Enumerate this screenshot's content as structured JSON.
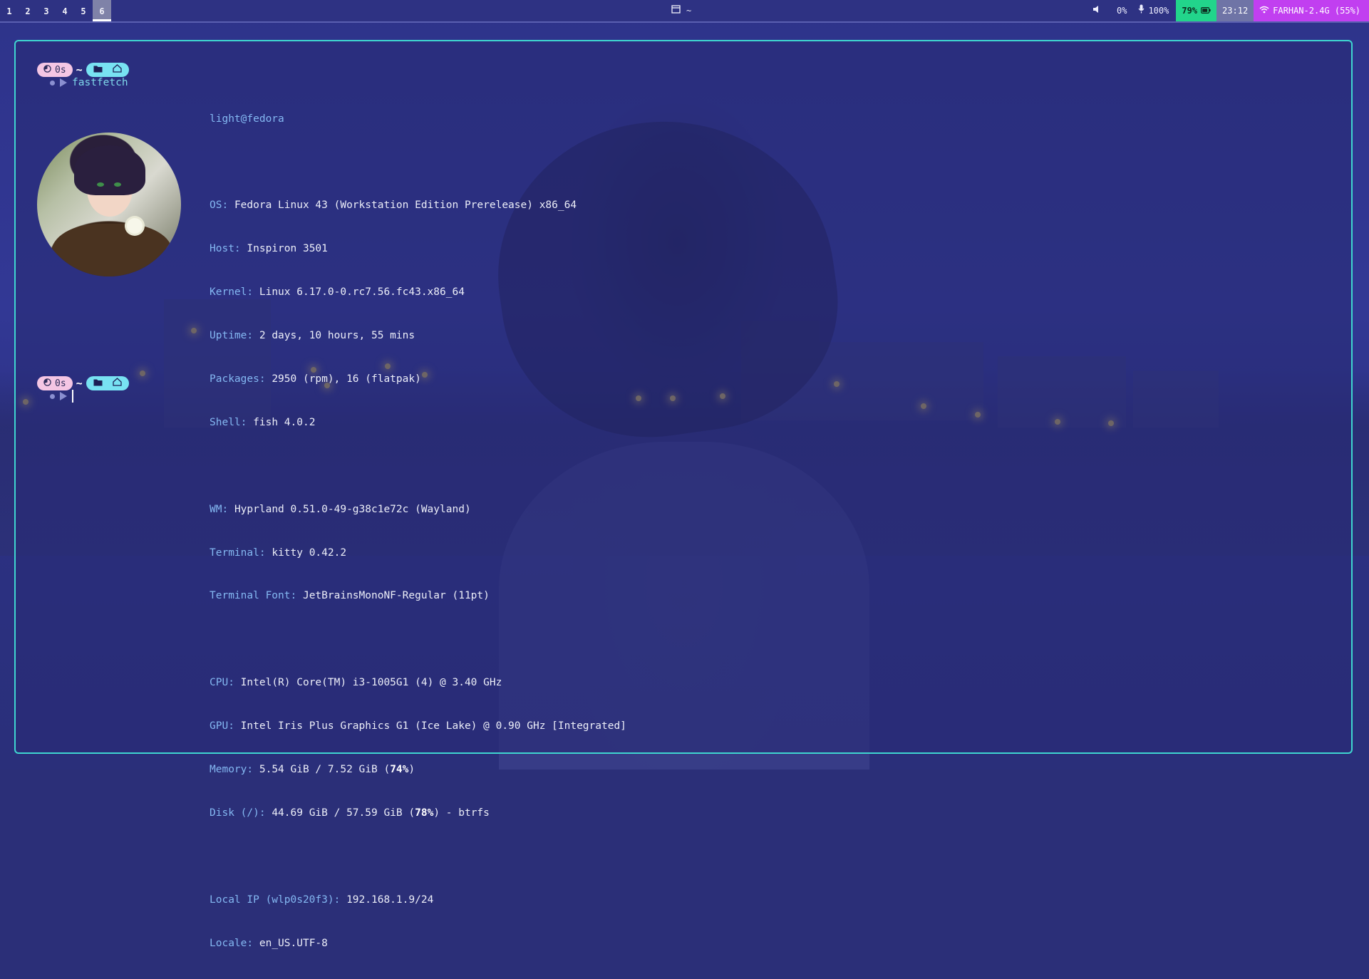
{
  "topbar": {
    "workspaces": [
      "1",
      "2",
      "3",
      "4",
      "5",
      "6"
    ],
    "active_workspace": "6",
    "window_title": "~",
    "volume": "0%",
    "mic": "100%",
    "battery": "79%",
    "clock": "23:12",
    "wifi": "FARHAN-2.4G (55%)"
  },
  "terminal": {
    "prompt": {
      "time": "0s",
      "path": "~"
    },
    "command": "fastfetch",
    "user_host": "light@fedora",
    "info": [
      {
        "key": "OS",
        "value": "Fedora Linux 43 (Workstation Edition Prerelease) x86_64"
      },
      {
        "key": "Host",
        "value": "Inspiron 3501"
      },
      {
        "key": "Kernel",
        "value": "Linux 6.17.0-0.rc7.56.fc43.x86_64"
      },
      {
        "key": "Uptime",
        "value": "2 days, 10 hours, 55 mins"
      },
      {
        "key": "Packages",
        "value": "2950 (rpm), 16 (flatpak)"
      },
      {
        "key": "Shell",
        "value": "fish 4.0.2"
      },
      {
        "key": "WM",
        "value": "Hyprland 0.51.0-49-g38c1e72c (Wayland)"
      },
      {
        "key": "Terminal",
        "value": "kitty 0.42.2"
      },
      {
        "key": "Terminal Font",
        "value": "JetBrainsMonoNF-Regular (11pt)"
      },
      {
        "key": "CPU",
        "value": "Intel(R) Core(TM) i3-1005G1 (4) @ 3.40 GHz"
      },
      {
        "key": "GPU",
        "value": "Intel Iris Plus Graphics G1 (Ice Lake) @ 0.90 GHz [Integrated]"
      },
      {
        "key": "Memory",
        "value_a": "5.54 GiB / 7.52 GiB (",
        "pct": "74%",
        "value_b": ")"
      },
      {
        "key": "Disk (/)",
        "value_a": "44.69 GiB / 57.59 GiB (",
        "pct": "78%",
        "value_b": ") - btrfs"
      },
      {
        "key": "Local IP (wlp0s20f3)",
        "value": "192.168.1.9/24"
      },
      {
        "key": "Locale",
        "value": "en_US.UTF-8"
      }
    ]
  },
  "icons": {
    "volume": "speaker-muted-icon",
    "mic": "microphone-icon",
    "battery": "battery-icon",
    "wifi": "wifi-icon",
    "window": "window-icon",
    "timer": "timer-icon",
    "folder": "folder-icon",
    "home": "home-icon"
  },
  "colors": {
    "accent_border": "#3fd6d0",
    "battery_bg": "#22d58b",
    "wifi_bg": "#c13ff0",
    "key_color": "#84b8f2",
    "pill_time": "#f4c6e4",
    "pill_dir": "#78e2f2"
  }
}
